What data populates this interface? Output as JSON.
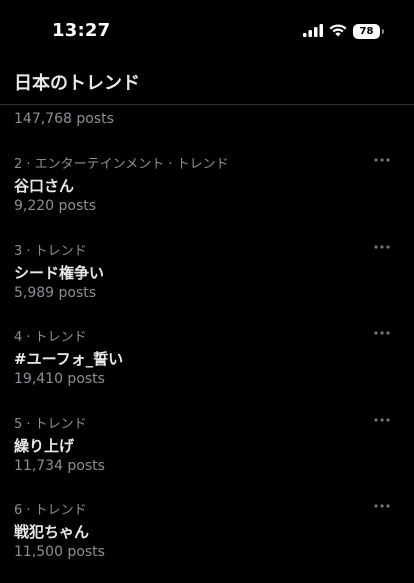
{
  "status_bar": {
    "time": "13:27",
    "battery": "78",
    "signal_icon": "cellular-signal-icon",
    "wifi_icon": "wifi-icon"
  },
  "header": {
    "title": "日本のトレンド"
  },
  "top_item": {
    "posts": "147,768 posts"
  },
  "trends": [
    {
      "meta": "2 · エンターテインメント · トレンド",
      "title": "谷口さん",
      "posts": "9,220 posts"
    },
    {
      "meta": "3 · トレンド",
      "title": "シード権争い",
      "posts": "5,989 posts"
    },
    {
      "meta": "4 · トレンド",
      "title": "#ユーフォ_誓い",
      "posts": "19,410 posts"
    },
    {
      "meta": "5 · トレンド",
      "title": "繰り上げ",
      "posts": "11,734 posts"
    },
    {
      "meta": "6 · トレンド",
      "title": "戦犯ちゃん",
      "posts": "11,500 posts"
    }
  ],
  "colors": {
    "background": "#000000",
    "primary_text": "#e7e9ea",
    "secondary_text": "#8b9096",
    "divider": "#2f3336"
  }
}
